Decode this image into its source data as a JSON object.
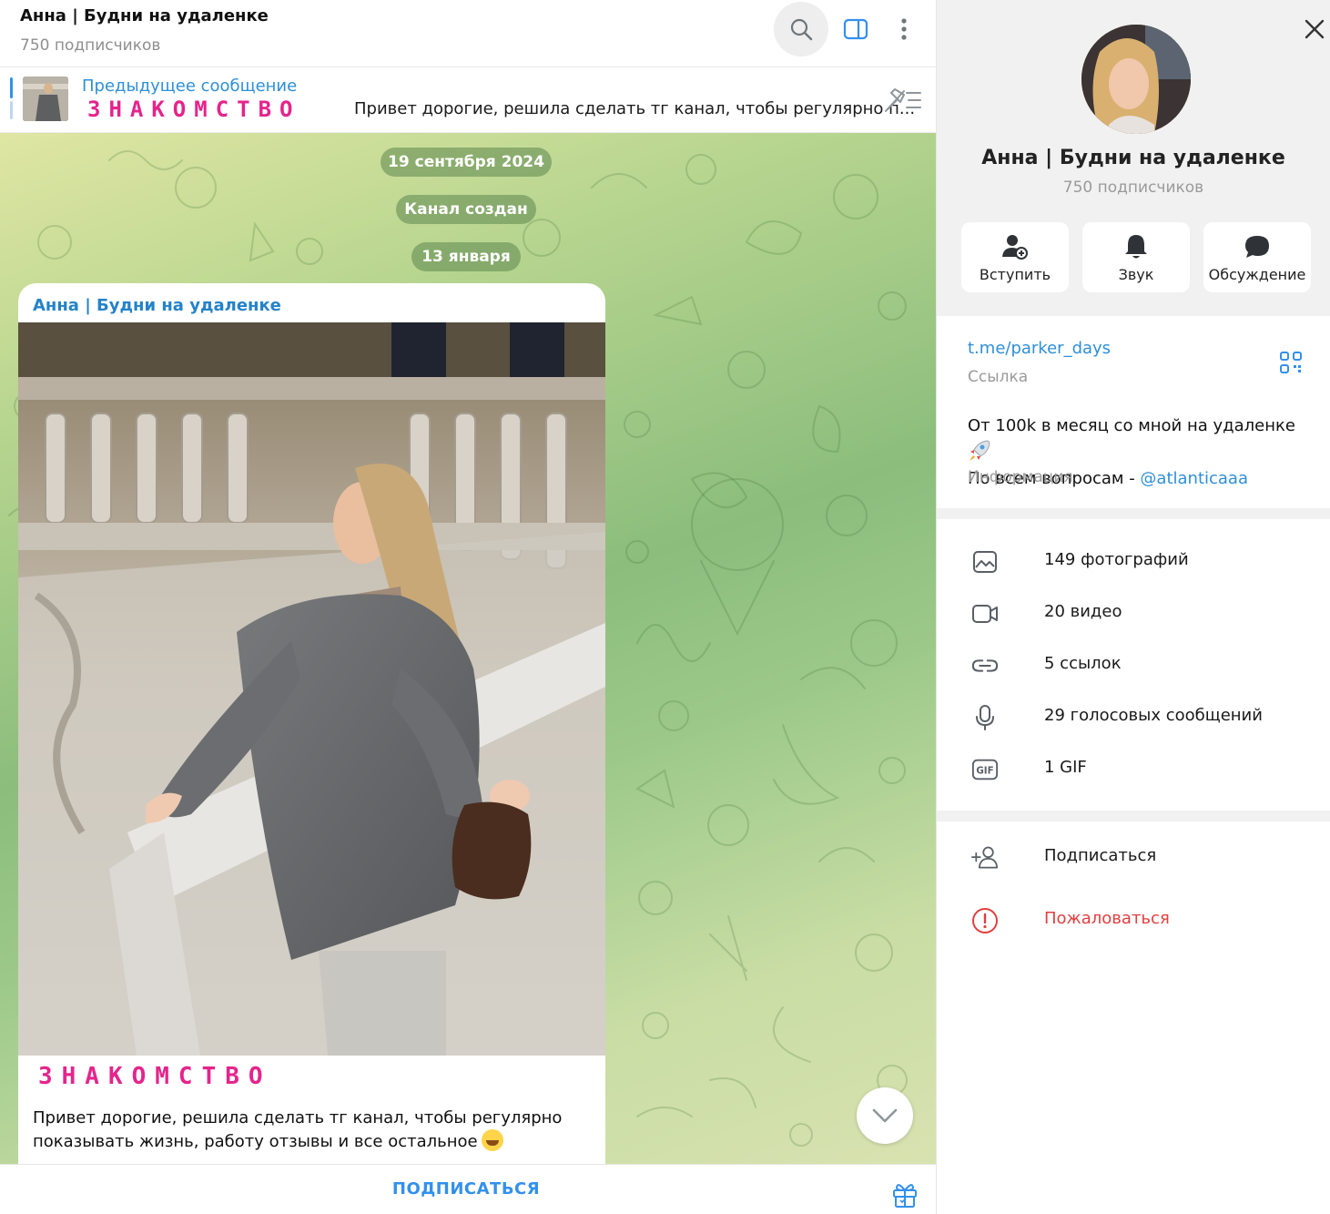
{
  "chat": {
    "title": "Анна | Будни на удаленке",
    "subtitle": "750 подписчиков",
    "header_icons": [
      "search-icon",
      "side-panel-icon",
      "more-vertical-icon"
    ]
  },
  "pinned": {
    "label": "Предыдущее сообщение",
    "decor": "ЗНАКОМСТВО",
    "text": "Привет дорогие, решила сделать тг канал, чтобы регулярно п..."
  },
  "service": {
    "date1": "19 сентября 2024",
    "created": "Канал создан",
    "date2": "13 января"
  },
  "message": {
    "author": "Анна | Будни на удаленке",
    "decor": "ЗНАКОМСТВО",
    "text": "Привет дорогие, решила сделать тг канал, чтобы регулярно показывать жизнь, работу отзывы и все остальное"
  },
  "bottom": {
    "subscribe": "ПОДПИСАТЬСЯ"
  },
  "profile": {
    "name": "Анна | Будни на удаленке",
    "subtitle": "750 подписчиков",
    "actions": [
      {
        "label": "Вступить",
        "icon": "add-user-icon"
      },
      {
        "label": "Звук",
        "icon": "bell-icon"
      },
      {
        "label": "Обсуждение",
        "icon": "chat-bubble-icon"
      }
    ],
    "link": {
      "value": "t.me/parker_days",
      "label": "Ссылка"
    },
    "info": {
      "line1": "От 100k в месяц со мной на удаленке",
      "line2_prefix": "По всем вопросам - ",
      "mention": "@atlanticaaa",
      "label": "Информация"
    },
    "media": [
      {
        "label": "149 фотографий",
        "icon": "photo-icon"
      },
      {
        "label": "20 видео",
        "icon": "video-icon"
      },
      {
        "label": "5 ссылок",
        "icon": "link-icon"
      },
      {
        "label": "29 голосовых сообщений",
        "icon": "microphone-icon"
      },
      {
        "label": "1 GIF",
        "icon": "gif-icon"
      }
    ],
    "subscribe": "Подписаться",
    "report": "Пожаловаться"
  },
  "colors": {
    "accent": "#3390ec",
    "link": "#2f8fd8",
    "decor_pink": "#e5248c",
    "danger": "#e0403f"
  }
}
